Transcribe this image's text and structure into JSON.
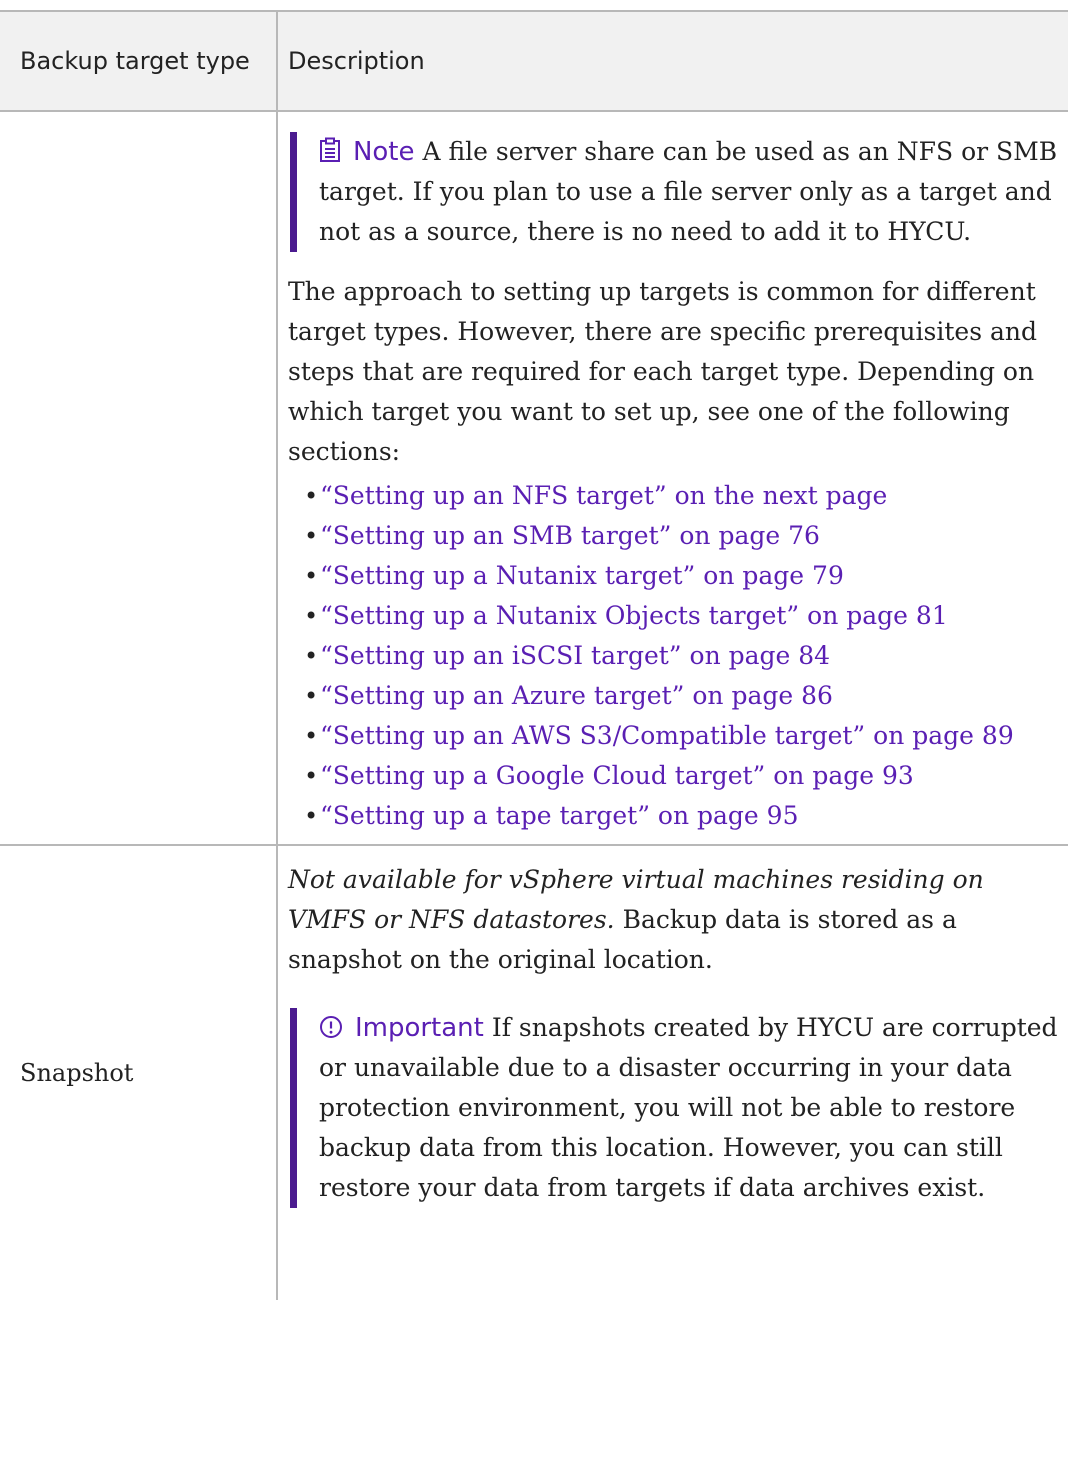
{
  "table": {
    "headers": {
      "col1": "Backup target type",
      "col2": "Description"
    },
    "row1": {
      "type": "",
      "note": {
        "icon": "clipboard-note-icon",
        "label": "Note",
        "text": "A file server share can be used as an NFS or SMB target. If you plan to use a file server only as a target and not as a source, there is no need to add it to HYCU."
      },
      "paragraph": "The approach to setting up targets is common for different target types. However, there are specific prerequisites and steps that are required for each target type. Depending on which target you want to set up, see one of the following sections:",
      "links": [
        "“Setting up an NFS target” on the next page",
        "“Setting up an SMB target” on page 76",
        "“Setting up a Nutanix target” on page 79",
        "“Setting up a Nutanix Objects target” on page 81",
        "“Setting up an iSCSI target” on page 84",
        "“Setting up an Azure target” on page 86",
        "“Setting up an AWS S3/Compatible target” on page 89",
        "“Setting up a Google Cloud target” on page 93",
        "“Setting up a tape target” on page 95"
      ]
    },
    "row2": {
      "type": "Snapshot",
      "italic_intro": "Not available for vSphere virtual machines residing on VMFS or NFS datastores.",
      "text": "Backup data is stored as a snapshot on the original location.",
      "important": {
        "icon": "alert-circle-icon",
        "label": "Important",
        "text": "If snapshots created by HYCU are corrupted or unavailable due to a disaster occurring in your data protection environment, you will not be able to restore backup data from this location. However, you can still restore your data from targets if data archives exist."
      }
    }
  },
  "colors": {
    "accent": "#5a1fb3",
    "callout_bar": "#4b1b8f",
    "header_bg": "#f1f1f1",
    "border": "#b8b8b8"
  }
}
